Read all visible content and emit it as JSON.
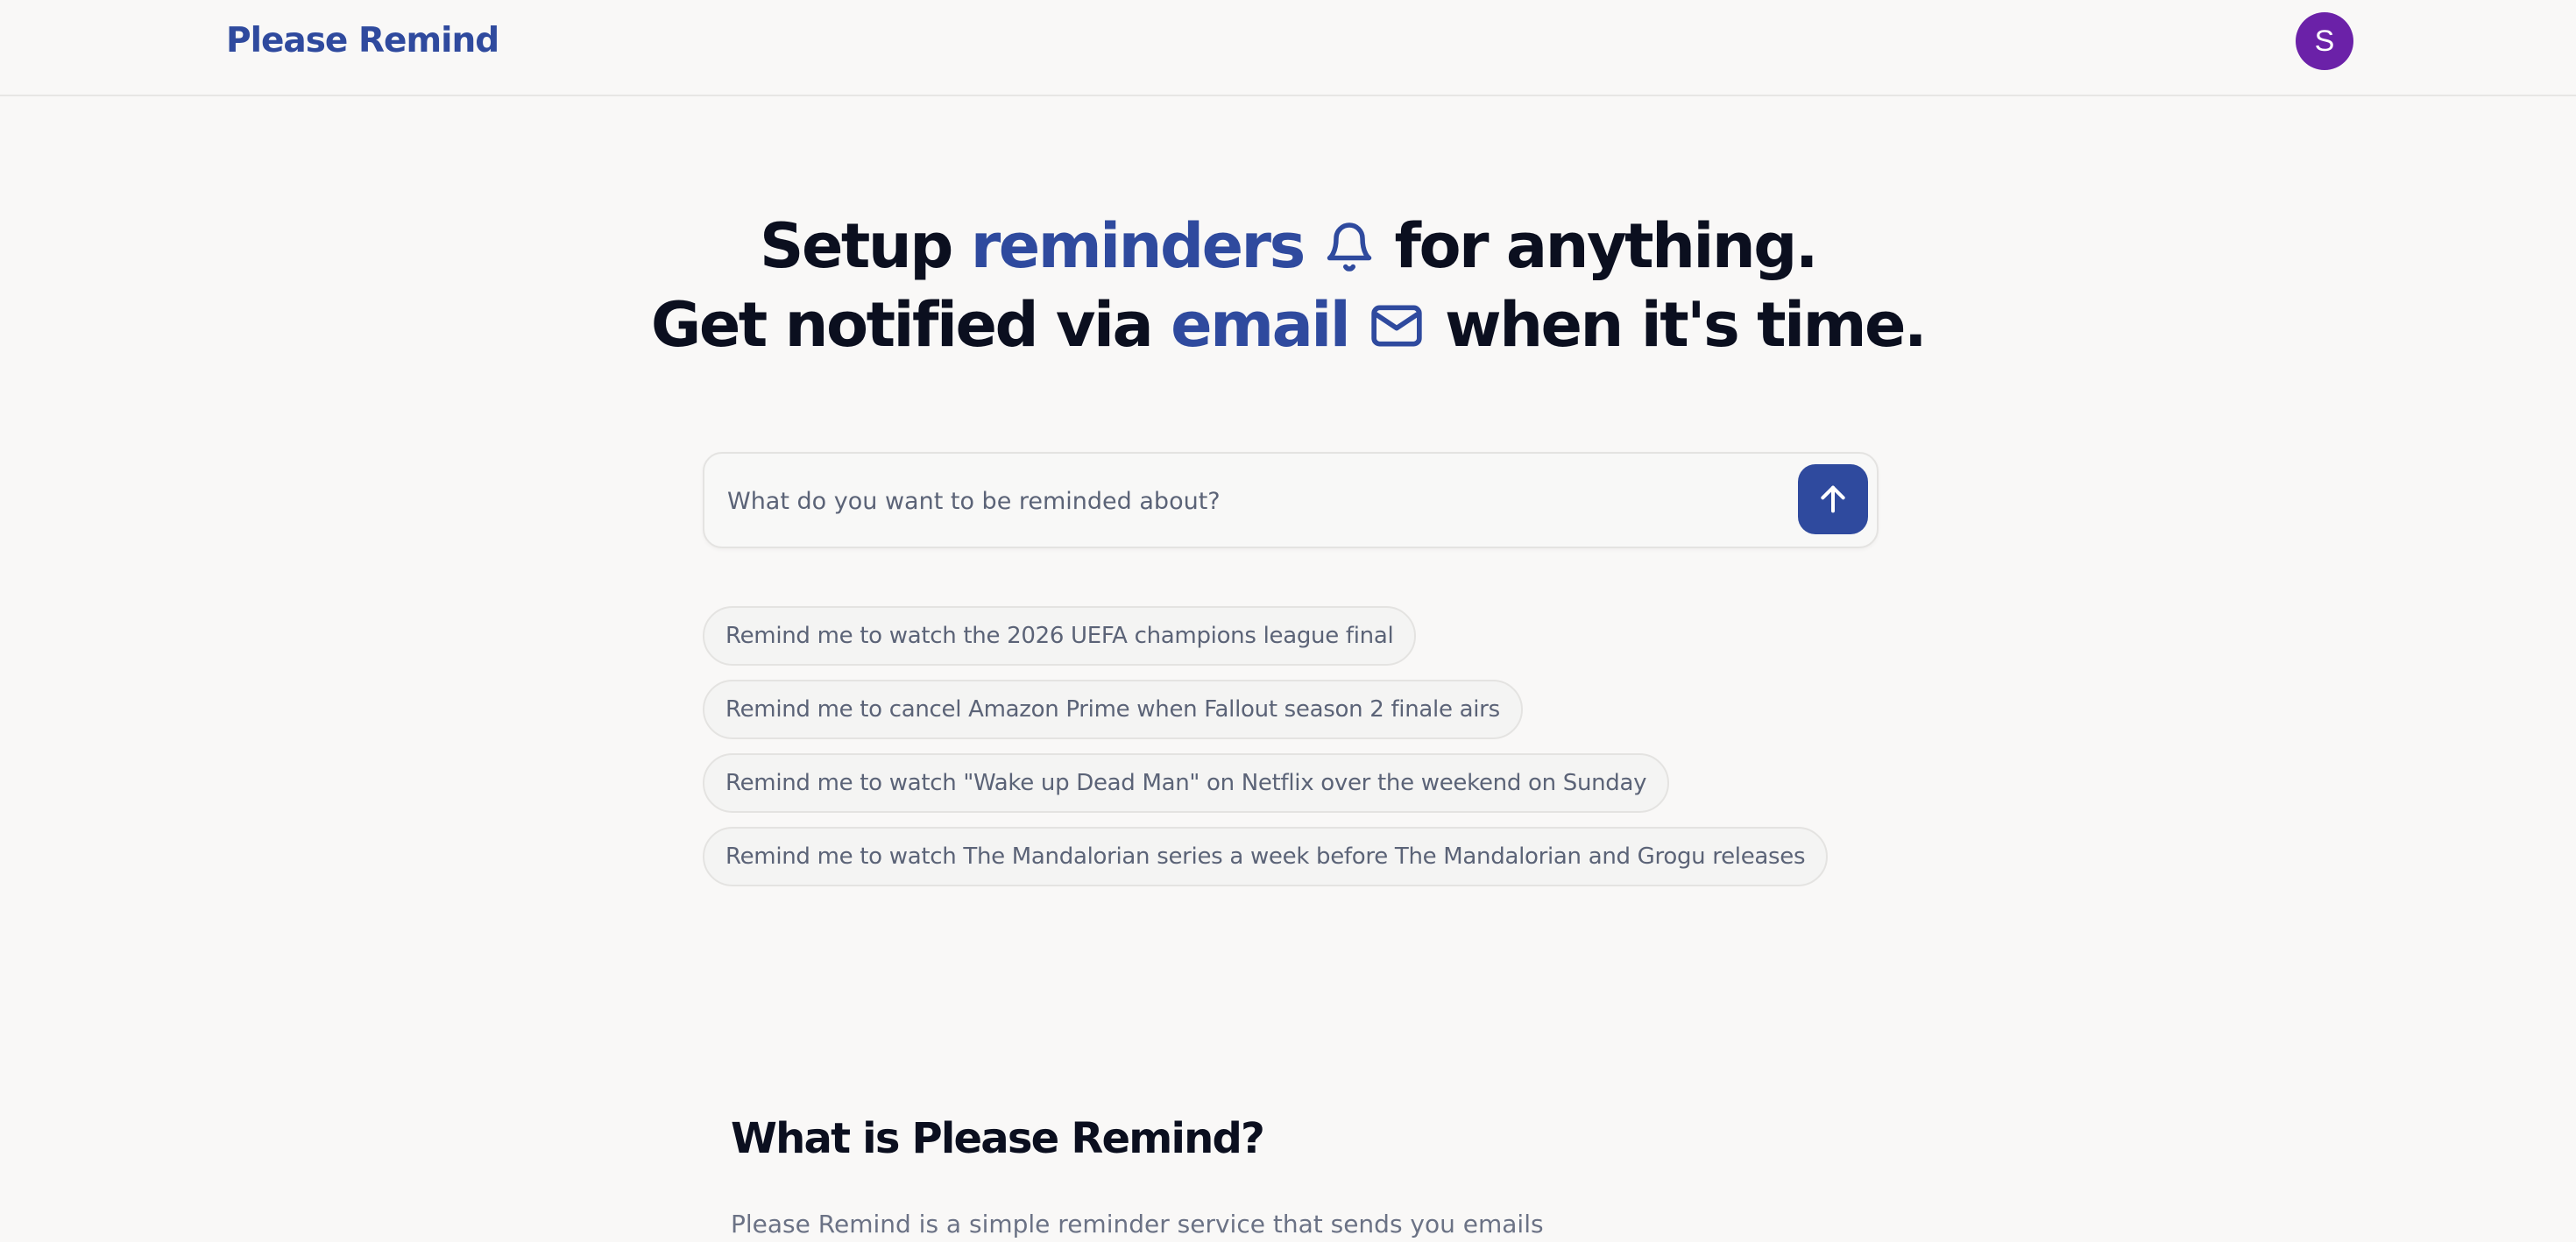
{
  "header": {
    "logo": "Please Remind",
    "avatar_initial": "S"
  },
  "hero": {
    "line1": {
      "before": "Setup ",
      "accent": "reminders",
      "icon": "bell-icon",
      "after": " for anything."
    },
    "line2": {
      "before": "Get notified via ",
      "accent": "email",
      "icon": "envelope-icon",
      "after": " when it's time."
    }
  },
  "prompt": {
    "placeholder": "What do you want to be reminded about?",
    "value": "",
    "submit_icon": "arrow-up-icon"
  },
  "suggestions": [
    "Remind me to watch the 2026 UEFA champions league final",
    "Remind me to cancel Amazon Prime when Fallout season 2 finale airs",
    "Remind me to watch \"Wake up Dead Man\" on Netflix over the weekend on Sunday",
    "Remind me to watch The Mandalorian series a week before The Mandalorian and Grogu releases"
  ],
  "about": {
    "title": "What is Please Remind?",
    "text_partial": "Please Remind is a simple reminder service that sends you emails"
  },
  "colors": {
    "accent": "#2f4a9e",
    "avatar": "#6b21a8",
    "background": "#f9f8f7",
    "text": "#0b0f1f",
    "muted": "#5b6377"
  }
}
